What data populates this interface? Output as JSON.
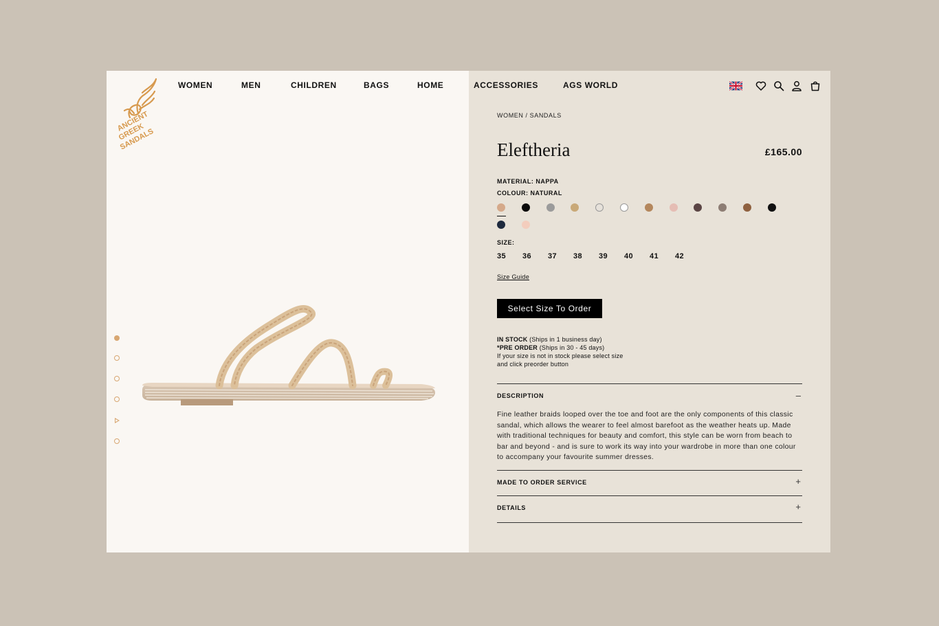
{
  "nav": {
    "items": [
      "WOMEN",
      "MEN",
      "CHILDREN",
      "BAGS",
      "HOME",
      "ACCESSORIES",
      "AGS WORLD"
    ]
  },
  "brand": {
    "logo_text": "ANCIENT GREEK SANDALS",
    "logo_color": "#d79a4f"
  },
  "header_icons": [
    "uk-flag-icon",
    "heart-icon",
    "search-icon",
    "account-icon",
    "bag-icon"
  ],
  "gallery": {
    "slides": 6,
    "active_index": 0,
    "video_slide_index": 4
  },
  "breadcrumb": {
    "level1": "WOMEN",
    "separator": "/",
    "level2": "SANDALS"
  },
  "product": {
    "title": "Eleftheria",
    "price": "£165.00",
    "material_line": "MATERIAL: NAPPA",
    "colour_line": "COLOUR: NATURAL",
    "colours": [
      "#d5a98a",
      "#0a0a0a",
      "#9b9b9b",
      "#c9a978",
      "#e6e1da",
      "#ffffff",
      "#b4875d",
      "#e5bdb4",
      "#5b4545",
      "#8d7d74",
      "#8f6140",
      "#111111",
      "#1e2a3e",
      "#f3cdbd"
    ],
    "selected_colour_index": 0,
    "size_label": "SIZE:",
    "sizes": [
      "35",
      "36",
      "37",
      "38",
      "39",
      "40",
      "41",
      "42"
    ],
    "size_guide": "Size Guide",
    "order_button": "Select Size To Order"
  },
  "stock": {
    "in_stock_label": "IN STOCK",
    "in_stock_note": " (Ships in 1 business day)",
    "preorder_label": "*PRE ORDER",
    "preorder_note": " (Ships in 30 - 45 days)",
    "line3": "If your size is not in stock please select size",
    "line4": "and click preorder button"
  },
  "accordion": {
    "description": {
      "title": "DESCRIPTION",
      "sign": "–",
      "text": "Fine leather braids looped over the toe and foot are the only components of this classic sandal, which allows the wearer to feel almost barefoot as the weather heats up. Made with traditional techniques for beauty and comfort, this style can be worn from beach to bar and beyond - and is sure to work its way into your wardrobe in more than one colour to accompany your favourite summer dresses."
    },
    "made_to_order": {
      "title": "MADE TO ORDER SERVICE",
      "sign": "+"
    },
    "details": {
      "title": "DETAILS",
      "sign": "+"
    }
  }
}
